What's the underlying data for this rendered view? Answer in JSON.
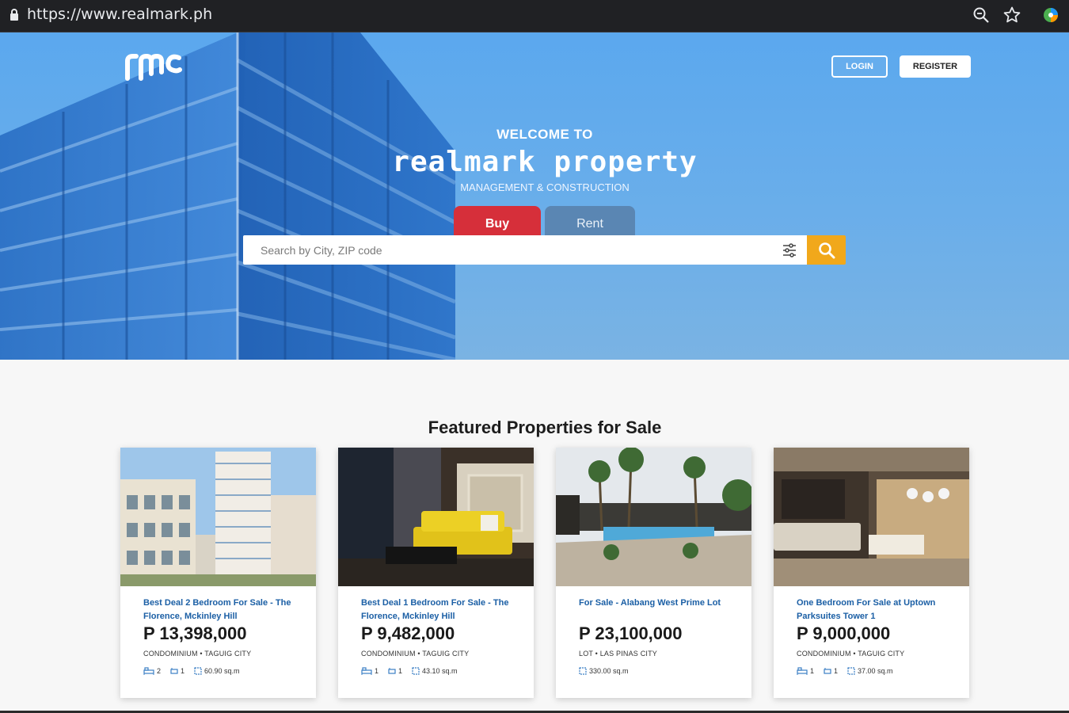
{
  "browser": {
    "url": "https://www.realmark.ph"
  },
  "header": {
    "login_label": "LOGIN",
    "register_label": "REGISTER"
  },
  "hero": {
    "welcome": "WELCOME TO",
    "brand": "realmark property",
    "tagline": "MANAGEMENT & CONSTRUCTION",
    "tabs": {
      "buy": "Buy",
      "rent": "Rent"
    },
    "search": {
      "placeholder": "Search by City, ZIP code"
    }
  },
  "featured": {
    "title": "Featured Properties for Sale",
    "cards": [
      {
        "title": "Best Deal 2 Bedroom For Sale - The Florence, Mckinley Hill",
        "price": "P 13,398,000",
        "type": "CONDOMINIUM • TAGUIG CITY",
        "beds": "2",
        "baths": "1",
        "area": "60.90 sq.m"
      },
      {
        "title": "Best Deal 1 Bedroom For Sale - The Florence, Mckinley Hill",
        "price": "P 9,482,000",
        "type": "CONDOMINIUM • TAGUIG CITY",
        "beds": "1",
        "baths": "1",
        "area": "43.10 sq.m"
      },
      {
        "title": "For Sale - Alabang West Prime Lot",
        "price": "P 23,100,000",
        "type": "LOT • LAS PINAS CITY",
        "area": "330.00 sq.m"
      },
      {
        "title": "One Bedroom For Sale at Uptown Parksuites Tower 1",
        "price": "P 9,000,000",
        "type": "CONDOMINIUM • TAGUIG CITY",
        "beds": "1",
        "baths": "1",
        "area": "37.00 sq.m"
      }
    ]
  },
  "colors": {
    "accent_buy": "#d62f3a",
    "accent_search": "#f1a81b",
    "title_link": "#1b5fa5",
    "hero_sky": "#5ba8ee"
  }
}
